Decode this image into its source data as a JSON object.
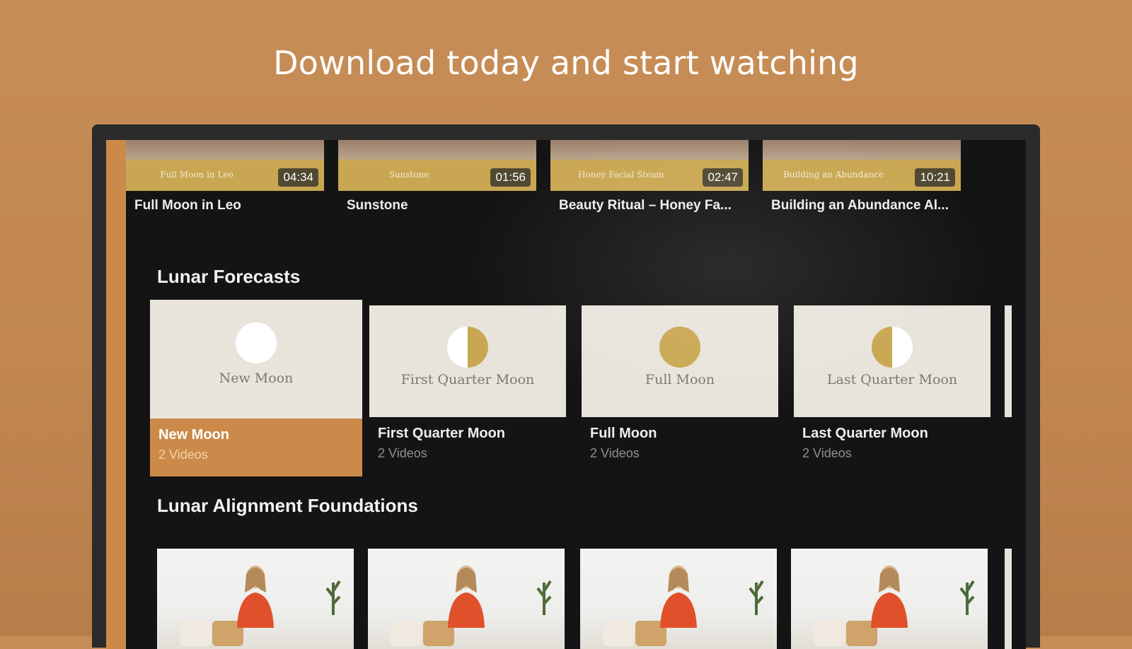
{
  "headline": "Download today and start watching",
  "colors": {
    "accent": "#cc8a4a",
    "gold": "#c9a752",
    "background": "#c28751",
    "screen": "#141414"
  },
  "top_row": [
    {
      "thumb_text": "Full Moon in Leo",
      "duration": "04:34",
      "title": "Full Moon in Leo"
    },
    {
      "thumb_text": "Sunstone",
      "duration": "01:56",
      "title": "Sunstone"
    },
    {
      "thumb_text": "Honey Facial Steam",
      "duration": "02:47",
      "title": "Beauty Ritual – Honey Fa..."
    },
    {
      "thumb_text": "Building an Abundance",
      "duration": "10:21",
      "title": "Building an Abundance Al..."
    }
  ],
  "lunar_forecasts": {
    "title": "Lunar Forecasts",
    "cards": [
      {
        "thumb_label": "New Moon",
        "name": "New Moon",
        "count": "2 Videos",
        "phase": "new",
        "focused": true
      },
      {
        "thumb_label": "First Quarter Moon",
        "name": "First Quarter Moon",
        "count": "2 Videos",
        "phase": "first-quarter"
      },
      {
        "thumb_label": "Full Moon",
        "name": "Full Moon",
        "count": "2 Videos",
        "phase": "full"
      },
      {
        "thumb_label": "Last Quarter Moon",
        "name": "Last Quarter Moon",
        "count": "2 Videos",
        "phase": "last-quarter"
      }
    ]
  },
  "foundations": {
    "title": "Lunar Alignment Foundations"
  }
}
